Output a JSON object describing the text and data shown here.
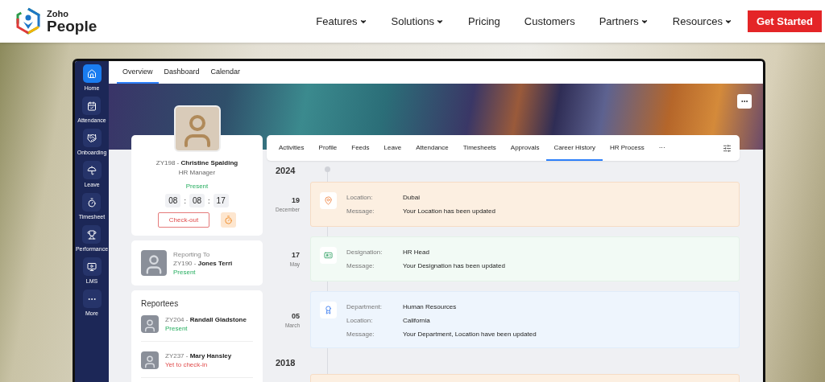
{
  "nav": {
    "logo": {
      "top": "Zoho",
      "name": "People"
    },
    "items": [
      {
        "label": "Features",
        "dropdown": true
      },
      {
        "label": "Solutions",
        "dropdown": true
      },
      {
        "label": "Pricing",
        "dropdown": false
      },
      {
        "label": "Customers",
        "dropdown": false
      },
      {
        "label": "Partners",
        "dropdown": true
      },
      {
        "label": "Resources",
        "dropdown": true
      }
    ],
    "cta": "Get Started"
  },
  "sidebar": {
    "items": [
      {
        "label": "Home",
        "selected": true
      },
      {
        "label": "Attendance",
        "selected": false
      },
      {
        "label": "Onboarding",
        "selected": false
      },
      {
        "label": "Leave",
        "selected": false
      },
      {
        "label": "Timesheet",
        "selected": false
      },
      {
        "label": "Performance",
        "selected": false
      },
      {
        "label": "LMS",
        "selected": false
      },
      {
        "label": "More",
        "selected": false
      }
    ]
  },
  "tabs": [
    {
      "label": "Overview",
      "selected": true
    },
    {
      "label": "Dashboard",
      "selected": false
    },
    {
      "label": "Calendar",
      "selected": false
    }
  ],
  "profile": {
    "name": "ZY198 - **Christine Spalding**",
    "role": "HR Manager",
    "status": "Present",
    "timer": [
      "08",
      "08",
      "17"
    ],
    "separator": ":",
    "checkout": "Check-out"
  },
  "reporting": {
    "title": "Reporting To",
    "name": "ZY190 - **Jones Terri**",
    "status": "Present",
    "kind": "present"
  },
  "reportees": {
    "title": "Reportees",
    "items": [
      {
        "name": "ZY204 - **Randall Gladstone**",
        "status": "Present",
        "kind": "present"
      },
      {
        "name": "ZY237 - **Mary Hansley**",
        "status": "Yet to check-in",
        "kind": "pending"
      }
    ]
  },
  "section_tabs": [
    {
      "label": "Activities",
      "selected": false
    },
    {
      "label": "Profile",
      "selected": false
    },
    {
      "label": "Feeds",
      "selected": false
    },
    {
      "label": "Leave",
      "selected": false
    },
    {
      "label": "Attendance",
      "selected": false
    },
    {
      "label": "Timesheets",
      "selected": false
    },
    {
      "label": "Approvals",
      "selected": false
    },
    {
      "label": "Career History",
      "selected": true
    },
    {
      "label": "HR Process",
      "selected": false
    },
    {
      "label": "···",
      "selected": false
    }
  ],
  "timeline": [
    {
      "year": "2024",
      "entries": [
        {
          "day": "19",
          "month": "December",
          "kind": "location",
          "fields": [
            {
              "label": "Location:",
              "value": "Dubai"
            },
            {
              "label": "Message:",
              "value": "Your Location has been updated"
            }
          ]
        },
        {
          "day": "17",
          "month": "May",
          "kind": "designation",
          "fields": [
            {
              "label": "Designation:",
              "value": "HR Head"
            },
            {
              "label": "Message:",
              "value": "Your Designation has been updated"
            }
          ]
        },
        {
          "day": "05",
          "month": "March",
          "kind": "department",
          "fields": [
            {
              "label": "Department:",
              "value": "Human Resources"
            },
            {
              "label": "Location:",
              "value": "California"
            },
            {
              "label": "Message:",
              "value": "Your Department, Location have been updated"
            }
          ]
        }
      ]
    },
    {
      "year": "2018",
      "entries": [
        {
          "kind": "location"
        }
      ]
    }
  ]
}
